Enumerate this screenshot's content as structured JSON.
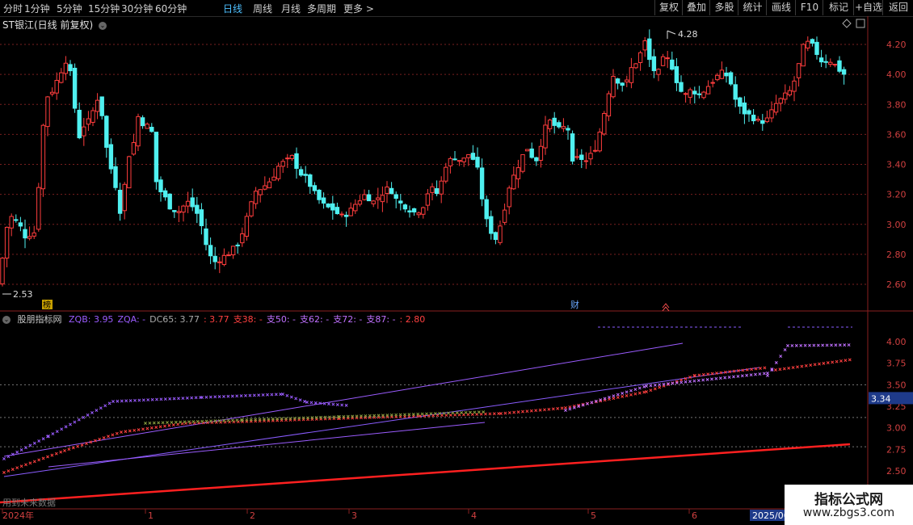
{
  "toolbar": {
    "periods": [
      {
        "label": "分时"
      },
      {
        "label": "1分钟"
      },
      {
        "label": "5分钟"
      },
      {
        "label": "15分钟"
      },
      {
        "label": "30分钟"
      },
      {
        "label": "60分钟"
      },
      {
        "label": "日线",
        "active": true
      },
      {
        "label": "周线"
      },
      {
        "label": "月线"
      },
      {
        "label": "多周期"
      },
      {
        "label": "更多 >"
      }
    ],
    "right_buttons": [
      {
        "label": "复权"
      },
      {
        "label": "叠加"
      },
      {
        "label": "多股"
      },
      {
        "label": "统计"
      },
      {
        "label": "画线"
      },
      {
        "label": "F10"
      },
      {
        "label": "标记"
      },
      {
        "label": "+自选"
      },
      {
        "label": "返回"
      }
    ]
  },
  "main_chart": {
    "title": "ST银江(日线 前复权)",
    "price_ticks": [
      "4.20",
      "4.00",
      "3.80",
      "3.60",
      "3.40",
      "3.20",
      "3.00",
      "2.80",
      "2.60"
    ],
    "high_label": "4.28",
    "low_label": "2.53",
    "markers": [
      {
        "text": "榜"
      },
      {
        "text": "财"
      }
    ],
    "colors": {
      "up": "#ff3d3d",
      "down": "#4ff0f0",
      "grid": "#7a1f1f"
    }
  },
  "indicator": {
    "name": "股朋指标网",
    "values": [
      {
        "text": "ZQB: 3.95",
        "color": "#9b5cff"
      },
      {
        "text": "ZQA: -",
        "color": "#9b5cff"
      },
      {
        "text": "DC65: 3.77",
        "color": "#aaaaaa"
      },
      {
        "text": ": 3.77",
        "color": "#ff4040"
      },
      {
        "text": "支38: -",
        "color": "#ff4040"
      },
      {
        "text": "支50: -",
        "color": "#c070ff"
      },
      {
        "text": "支62: -",
        "color": "#c070ff"
      },
      {
        "text": "支72: -",
        "color": "#c070ff"
      },
      {
        "text": "支87: -",
        "color": "#c070ff"
      },
      {
        "text": ": 2.80",
        "color": "#ff4040"
      }
    ],
    "ticks": [
      "4.00",
      "3.75",
      "3.50",
      "3.25",
      "3.00",
      "2.75",
      "2.50"
    ],
    "current_value": "3.34",
    "footer_text": "用到未来数据"
  },
  "time_axis": {
    "labels": [
      "2024年",
      "1",
      "2",
      "3",
      "4",
      "5",
      "6"
    ],
    "highlight": "2025/06"
  },
  "watermark": {
    "line1": "指标公式网",
    "line2": "www.zbgs3.com"
  }
}
